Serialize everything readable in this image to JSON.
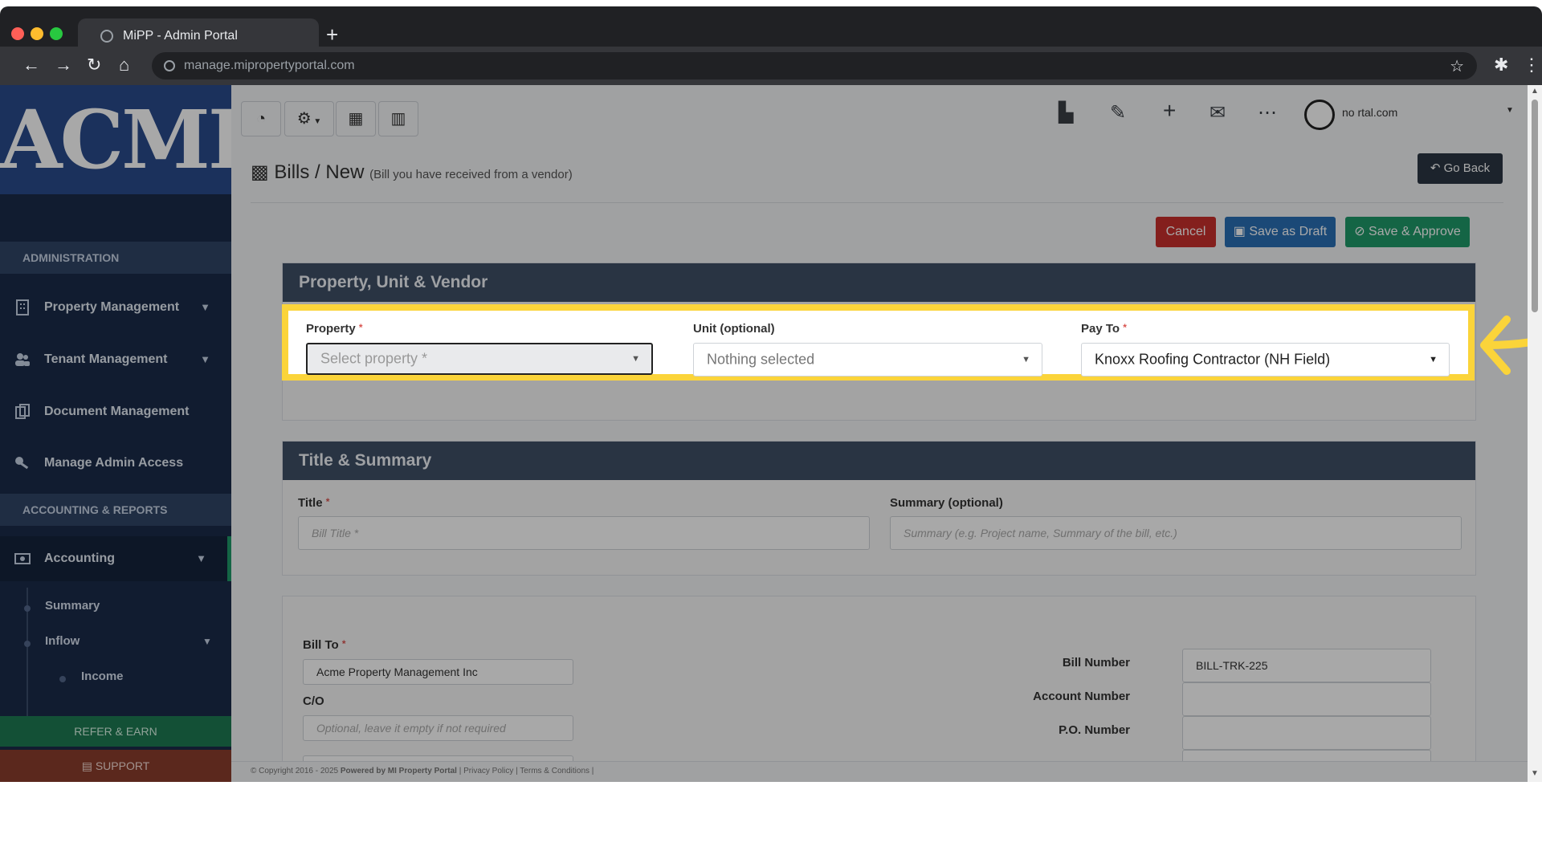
{
  "browser": {
    "tab_title": "MiPP - Admin Portal",
    "new_tab": "+",
    "url": "manage.mipropertyportal.com"
  },
  "sidebar": {
    "logo": "ACME",
    "sections": {
      "administration": "ADMINISTRATION",
      "accounting_reports": "ACCOUNTING & REPORTS"
    },
    "items": [
      {
        "label": "Property Management",
        "icon": "building-icon"
      },
      {
        "label": "Tenant Management",
        "icon": "users-icon"
      },
      {
        "label": "Document Management",
        "icon": "documents-icon"
      },
      {
        "label": "Manage Admin Access",
        "icon": "key-icon"
      },
      {
        "label": "Accounting",
        "icon": "money-icon"
      }
    ],
    "accounting_sub": {
      "summary": "Summary",
      "inflow": "Inflow",
      "income": "Income"
    },
    "refer_label": "REFER & EARN",
    "support_label": "SUPPORT"
  },
  "topbar": {
    "user_email": "no                            rtal.com"
  },
  "page": {
    "breadcrumb_parent": "Bills",
    "breadcrumb_sep": "/",
    "breadcrumb_current": "New",
    "subtitle": "(Bill you have received from a vendor)",
    "go_back": "Go Back"
  },
  "actions": {
    "cancel": "Cancel",
    "save_draft": "Save as Draft",
    "save_approve": "Save & Approve"
  },
  "property_section": {
    "title": "Property, Unit & Vendor",
    "property_label": "Property",
    "property_placeholder": "Select property *",
    "unit_label": "Unit (optional)",
    "unit_value": "Nothing selected",
    "payto_label": "Pay To",
    "payto_value": "Knoxx Roofing Contractor (NH Field)"
  },
  "title_section": {
    "title": "Title & Summary",
    "title_label": "Title",
    "title_placeholder": "Bill Title *",
    "summary_label": "Summary (optional)",
    "summary_placeholder": "Summary (e.g. Project name, Summary of the bill, etc.)"
  },
  "bill_section": {
    "bill_to_label": "Bill To",
    "bill_to_value": "Acme Property Management Inc",
    "co_label": "C/O",
    "co_placeholder": "Optional, leave it empty if not required",
    "bill_number_label": "Bill Number",
    "bill_number_value": "BILL-TRK-225",
    "account_number_label": "Account Number",
    "po_number_label": "P.O. Number"
  },
  "footer": {
    "copyright": "© Copyright 2016 - 2025",
    "powered_by": "Powered by MI Property Portal",
    "links": "| Privacy Policy | Terms & Conditions |"
  },
  "colors": {
    "highlight": "#fbd43a",
    "cancel": "#c9302c",
    "draft": "#2a6fb5",
    "approve": "#1f9a6a"
  }
}
